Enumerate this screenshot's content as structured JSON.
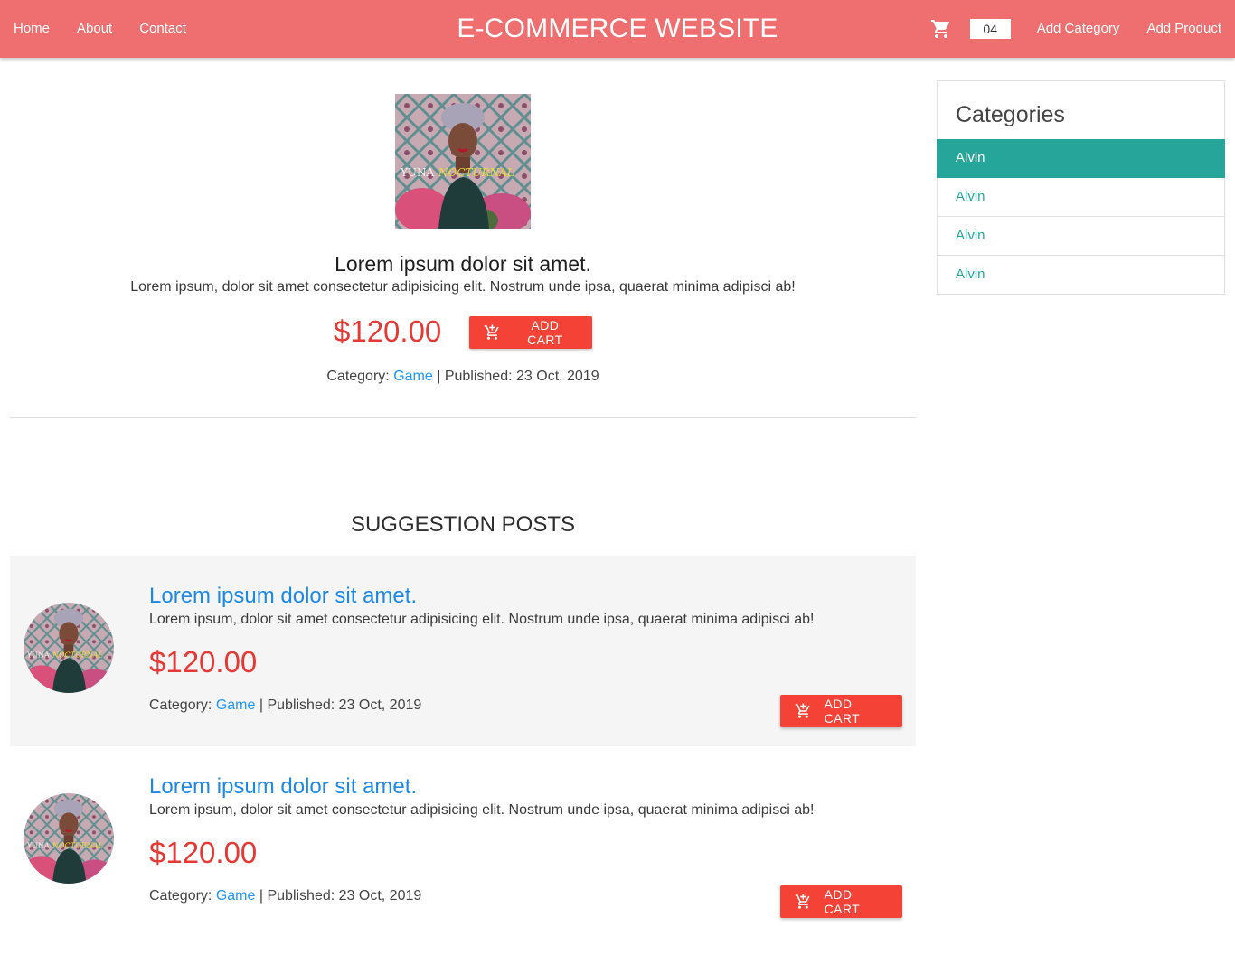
{
  "header": {
    "brand": "E-COMMERCE WEBSITE",
    "nav_links": [
      "Home",
      "About",
      "Contact"
    ],
    "cart_icon": "cart-icon",
    "cart_count": "04",
    "actions": [
      "Add Category",
      "Add Product"
    ]
  },
  "product": {
    "image_icon": "album-cover-image",
    "title": "Lorem ipsum dolor sit amet.",
    "description": "Lorem ipsum, dolor sit amet consectetur adipisicing elit. Nostrum unde ipsa, quaerat minima adipisci ab!",
    "price": "$120.00",
    "add_cart_label": "ADD CART",
    "add_cart_icon": "add-shopping-cart-icon",
    "category_label": "Category:",
    "category": "Game",
    "separator": "|",
    "published_label": "Published:",
    "published": "23 Oct, 2019"
  },
  "suggestions": {
    "heading": "SUGGESTION POSTS",
    "items": [
      {
        "title": "Lorem ipsum dolor sit amet.",
        "description": "Lorem ipsum, dolor sit amet consectetur adipisicing elit. Nostrum unde ipsa, quaerat minima adipisci ab!",
        "price": "$120.00",
        "category_label": "Category:",
        "category": "Game",
        "separator": "|",
        "published_label": "Published:",
        "published": "23 Oct, 2019",
        "add_cart_label": "ADD CART"
      },
      {
        "title": "Lorem ipsum dolor sit amet.",
        "description": "Lorem ipsum, dolor sit amet consectetur adipisicing elit. Nostrum unde ipsa, quaerat minima adipisci ab!",
        "price": "$120.00",
        "category_label": "Category:",
        "category": "Game",
        "separator": "|",
        "published_label": "Published:",
        "published": "23 Oct, 2019",
        "add_cart_label": "ADD CART"
      }
    ]
  },
  "sidebar": {
    "title": "Categories",
    "items": [
      {
        "label": "Alvin",
        "active": true
      },
      {
        "label": "Alvin",
        "active": false
      },
      {
        "label": "Alvin",
        "active": false
      },
      {
        "label": "Alvin",
        "active": false
      }
    ]
  },
  "colors": {
    "navbar": "#ef6f71",
    "price": "#e53935",
    "button": "#f44336",
    "link": "#1e88e5",
    "category_accent": "#26a69a",
    "suggestion_background": "#f5f5f5"
  }
}
